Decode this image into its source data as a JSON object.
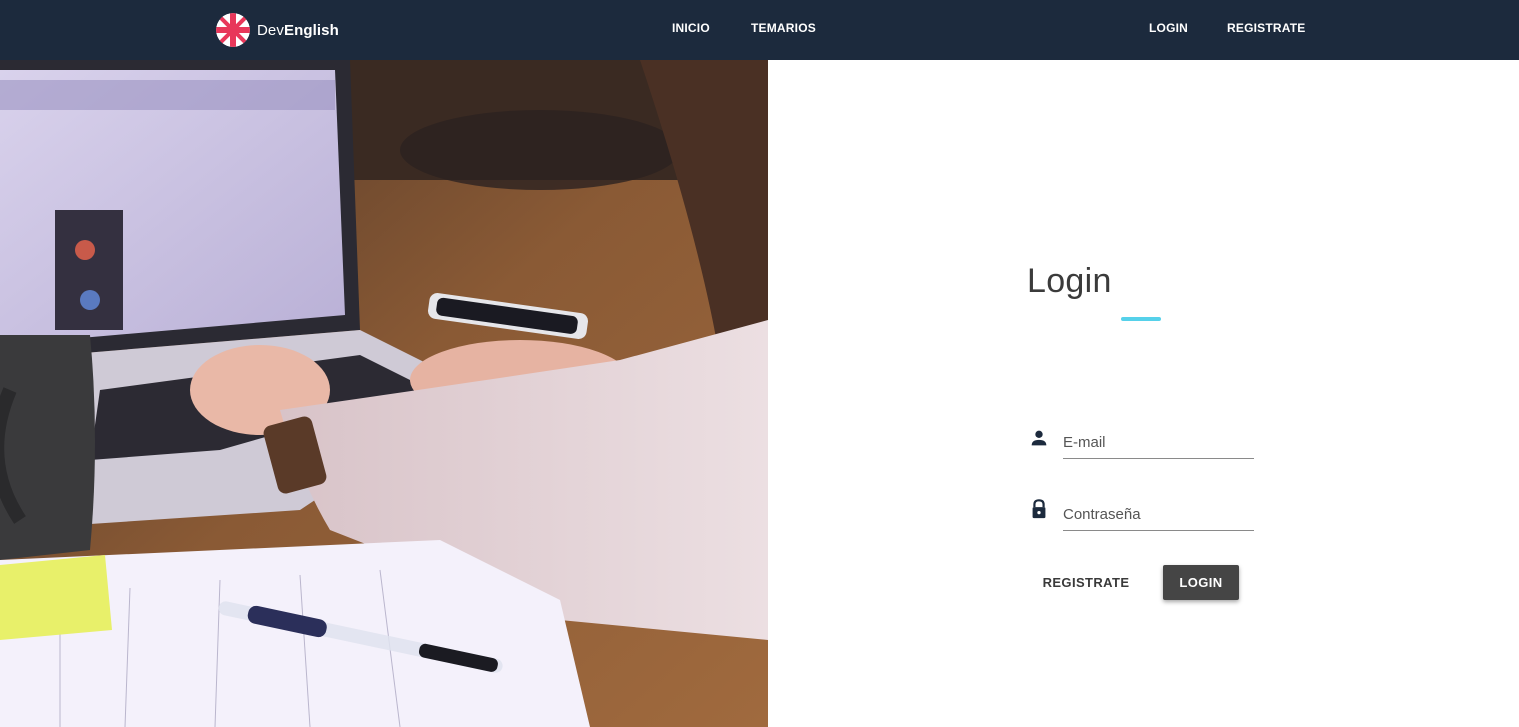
{
  "brand": {
    "name_light": "Dev",
    "name_bold": "English",
    "logo_icon": "uk-flag-icon"
  },
  "nav": {
    "links": [
      "INICIO",
      "TEMARIOS"
    ],
    "auth_links": [
      "LOGIN",
      "REGISTRATE"
    ]
  },
  "login": {
    "title": "Login",
    "email_placeholder": "E-mail",
    "password_placeholder": "Contraseña",
    "register_button": "REGISTRATE",
    "login_button": "LOGIN"
  },
  "colors": {
    "navbar": "#1c2a3d",
    "accent": "#56d1ea",
    "button_dark": "#454545"
  }
}
